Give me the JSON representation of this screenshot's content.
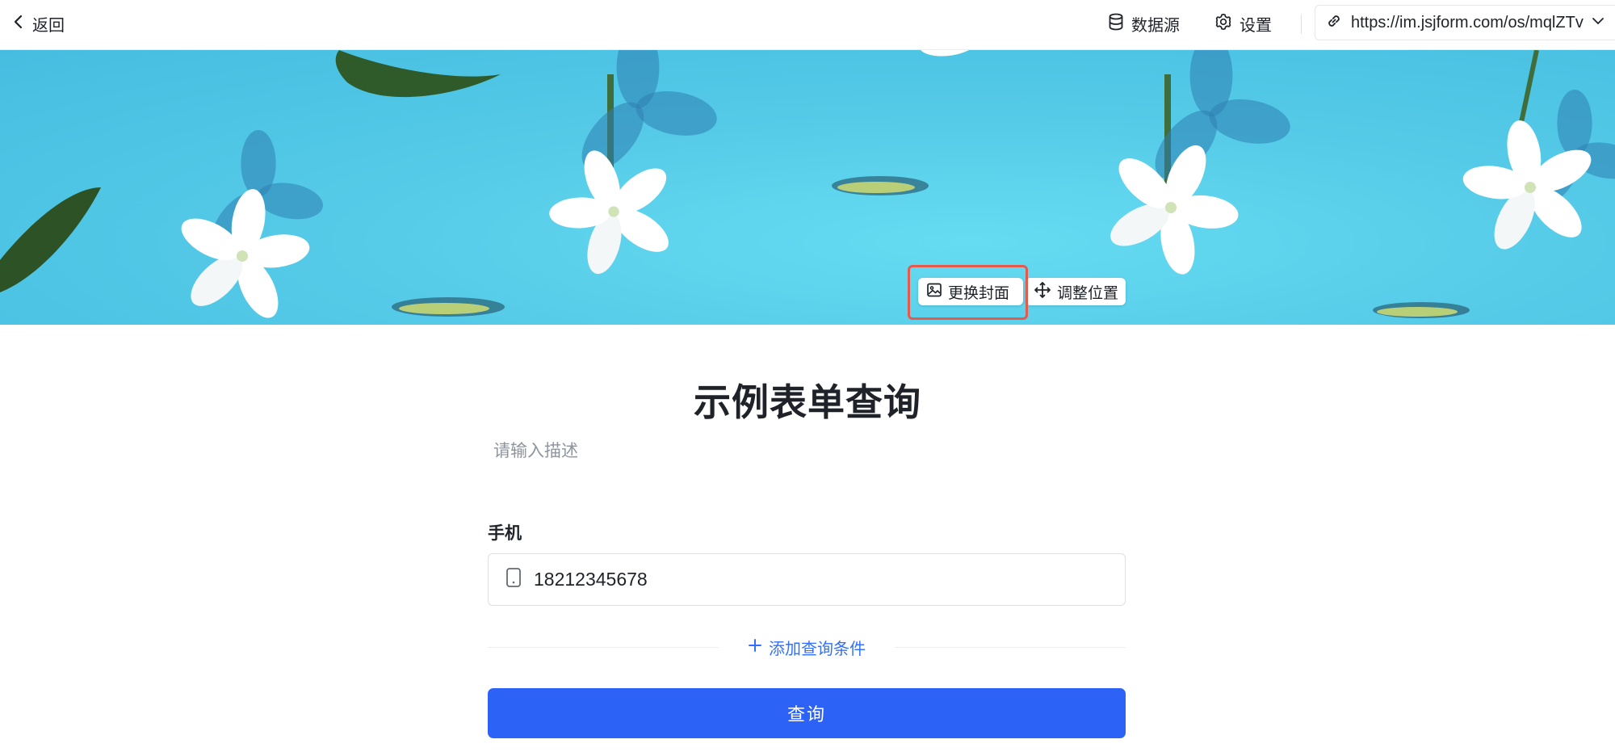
{
  "topbar": {
    "back_label": "返回",
    "datasource_label": "数据源",
    "settings_label": "设置",
    "url": "https://im.jsjform.com/os/mqlZTv"
  },
  "cover": {
    "change_cover_label": "更换封面",
    "adjust_position_label": "调整位置"
  },
  "form": {
    "title": "示例表单查询",
    "description_placeholder": "请输入描述",
    "fields": [
      {
        "label": "手机",
        "value": "18212345678",
        "icon": "phone-icon"
      }
    ],
    "add_condition_label": "添加查询条件",
    "submit_label": "查询"
  },
  "colors": {
    "primary": "#2d62f6",
    "link": "#3370ff",
    "highlight": "#e55a4b",
    "cover_bg": "#55cbe8"
  }
}
